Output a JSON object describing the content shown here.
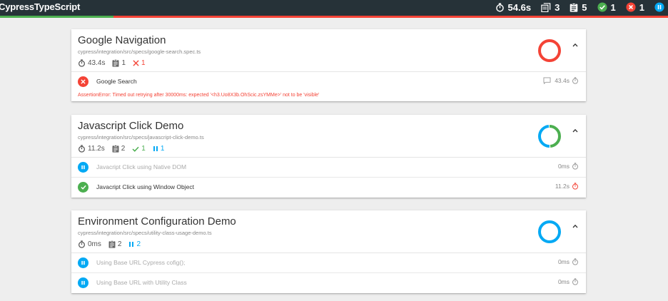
{
  "app": {
    "title": "CypressTypeScript"
  },
  "header_stats": {
    "duration": "54.6s",
    "suites": "3",
    "tests": "5",
    "passed": "1",
    "failed": "1",
    "pending": ""
  },
  "colors": {
    "pass": "#4caf50",
    "fail": "#f44336",
    "pending": "#03a9f4",
    "header_bg": "#263238"
  },
  "progress": {
    "pass_fraction": 0.17
  },
  "suites": [
    {
      "title": "Google Navigation",
      "file": "cypress/integration/src/specs/google-search.spec.ts",
      "duration": "43.4s",
      "test_count": "1",
      "failed": "1",
      "chart": {
        "pass": 0,
        "fail": 1,
        "pending": 0
      },
      "tests": [
        {
          "name": "Google Search",
          "duration": "43.4s",
          "state": "failed",
          "error": "AssertionError: Timed out retrying after 30000ms: expected '<h3.Uo8X3b.OhScic.zsYMMe>' not to be 'visible'"
        }
      ]
    },
    {
      "title": "Javascript Click Demo",
      "file": "cypress/integration/src/specs/javascript-click-demo.ts",
      "duration": "11.2s",
      "test_count": "2",
      "passed": "1",
      "pending": "1",
      "chart": {
        "pass": 1,
        "fail": 0,
        "pending": 1
      },
      "tests": [
        {
          "name": "Javacript Click using Native DOM",
          "duration": "0ms",
          "state": "pending"
        },
        {
          "name": "Javacript Click using Window Object",
          "duration": "11.2s",
          "state": "passed"
        }
      ]
    },
    {
      "title": "Environment Configuration Demo",
      "file": "cypress/integration/src/specs/utility-class-usage-demo.ts",
      "duration": "0ms",
      "test_count": "2",
      "pending": "2",
      "chart": {
        "pass": 0,
        "fail": 0,
        "pending": 2
      },
      "tests": [
        {
          "name": "Using Base URL Cypress cofig();",
          "duration": "0ms",
          "state": "pending"
        },
        {
          "name": "Using Base URL with Utility Class",
          "duration": "0ms",
          "state": "pending"
        }
      ]
    }
  ]
}
